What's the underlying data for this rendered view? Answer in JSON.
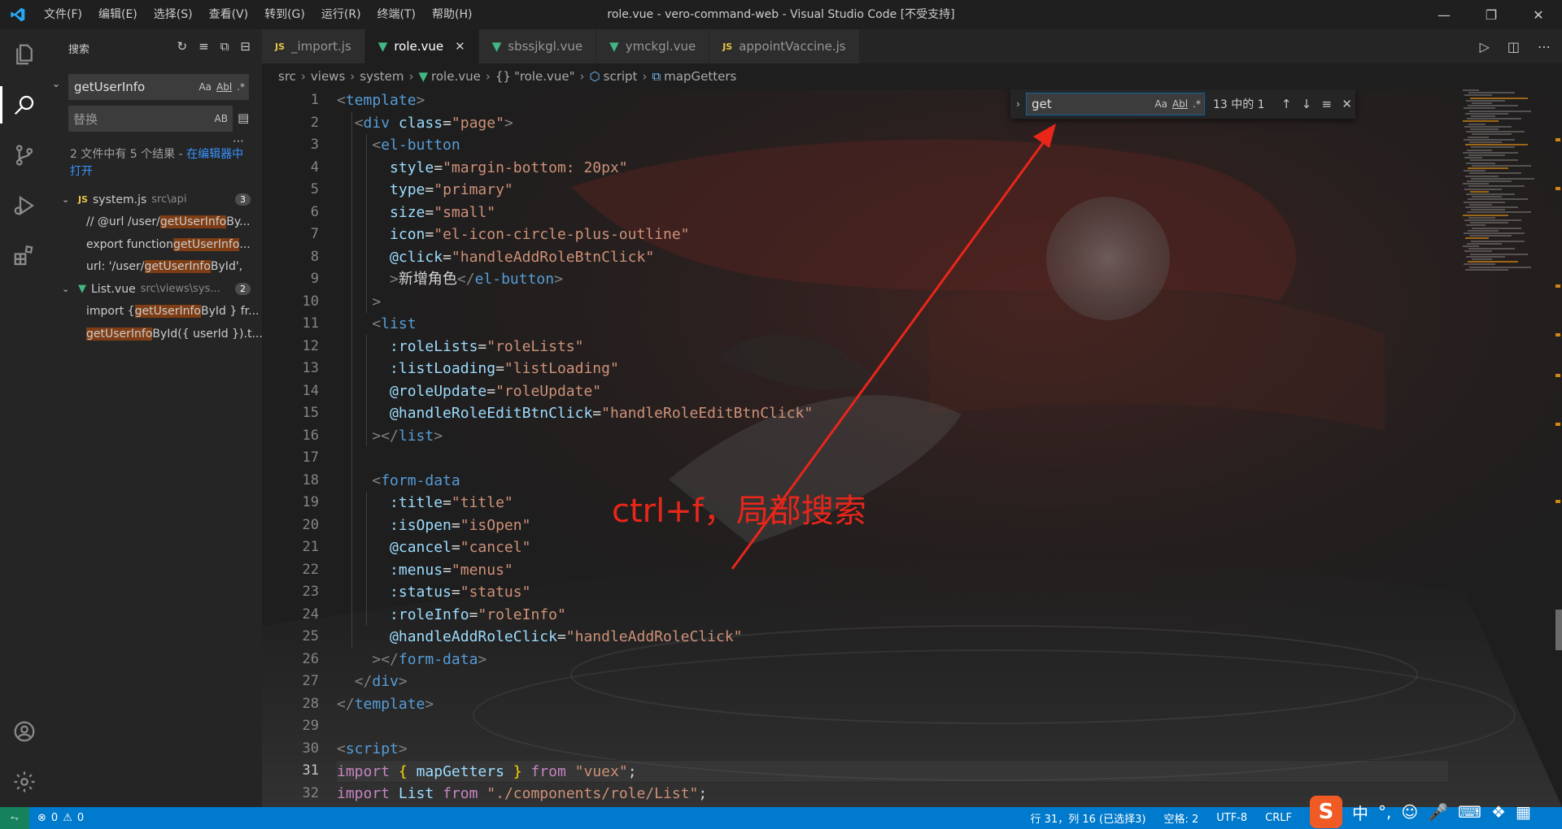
{
  "titlebar": {
    "menus": [
      "文件(F)",
      "编辑(E)",
      "选择(S)",
      "查看(V)",
      "转到(G)",
      "运行(R)",
      "终端(T)",
      "帮助(H)"
    ],
    "title": "role.vue - vero-command-web - Visual Studio Code [不受支持]"
  },
  "sidebar": {
    "header": "搜索",
    "search_value": "getUserInfo",
    "opt_case": "Aa",
    "opt_word": "Abl",
    "opt_regex": ".*",
    "replace_placeholder": "替换",
    "replace_opt": "AB",
    "results_msg": "2 文件中有 5 个结果 - ",
    "results_link": "在编辑器中打开",
    "files": [
      {
        "name": "system.js",
        "path": "src\\api",
        "count": "3",
        "type": "js",
        "matches": [
          {
            "pre": "// @url /user/",
            "hit": "getUserInfo",
            "post": "By..."
          },
          {
            "pre": "export function ",
            "hit": "getUserInfo",
            "post": "..."
          },
          {
            "pre": "url: '/user/",
            "hit": "getUserInfo",
            "post": "ById',"
          }
        ]
      },
      {
        "name": "List.vue",
        "path": "src\\views\\sys...",
        "count": "2",
        "type": "vue",
        "matches": [
          {
            "pre": "import { ",
            "hit": "getUserInfo",
            "post": "ById } fr..."
          },
          {
            "pre": "",
            "hit": "getUserInfo",
            "post": "ById({ userId }).t..."
          }
        ]
      }
    ]
  },
  "tabs": [
    {
      "label": "_import.js",
      "type": "js",
      "active": false
    },
    {
      "label": "role.vue",
      "type": "vue",
      "active": true
    },
    {
      "label": "sbssjkgl.vue",
      "type": "vue",
      "active": false
    },
    {
      "label": "ymckgl.vue",
      "type": "vue",
      "active": false
    },
    {
      "label": "appointVaccine.js",
      "type": "js",
      "active": false
    }
  ],
  "breadcrumb": {
    "items": [
      "src",
      "views",
      "system",
      "role.vue",
      "\"role.vue\"",
      "script",
      "mapGetters"
    ]
  },
  "find": {
    "value": "get",
    "opt_case": "Aa",
    "opt_word": "Abl",
    "opt_regex": ".*",
    "count": "13 中的 1"
  },
  "code": {
    "lines": [
      [
        [
          "b",
          "<"
        ],
        [
          "t",
          "template"
        ],
        [
          "b",
          ">"
        ]
      ],
      [
        [
          "w",
          "  "
        ],
        [
          "b",
          "<"
        ],
        [
          "t",
          "div"
        ],
        [
          "w",
          " "
        ],
        [
          "a",
          "class"
        ],
        [
          "w",
          "="
        ],
        [
          "s",
          "\"page\""
        ],
        [
          "b",
          ">"
        ]
      ],
      [
        [
          "w",
          "    "
        ],
        [
          "b",
          "<"
        ],
        [
          "t",
          "el-button"
        ]
      ],
      [
        [
          "w",
          "      "
        ],
        [
          "a",
          "style"
        ],
        [
          "w",
          "="
        ],
        [
          "s",
          "\"margin-bottom: 20px\""
        ]
      ],
      [
        [
          "w",
          "      "
        ],
        [
          "a",
          "type"
        ],
        [
          "w",
          "="
        ],
        [
          "s",
          "\"primary\""
        ]
      ],
      [
        [
          "w",
          "      "
        ],
        [
          "a",
          "size"
        ],
        [
          "w",
          "="
        ],
        [
          "s",
          "\"small\""
        ]
      ],
      [
        [
          "w",
          "      "
        ],
        [
          "a",
          "icon"
        ],
        [
          "w",
          "="
        ],
        [
          "s",
          "\"el-icon-circle-plus-outline\""
        ]
      ],
      [
        [
          "w",
          "      "
        ],
        [
          "a",
          "@click"
        ],
        [
          "w",
          "="
        ],
        [
          "s",
          "\"handleAddRoleBtnClick\""
        ]
      ],
      [
        [
          "w",
          "      "
        ],
        [
          "b",
          ">"
        ],
        [
          "w",
          "新增角色"
        ],
        [
          "b",
          "</"
        ],
        [
          "t",
          "el-button"
        ],
        [
          "b",
          ">"
        ]
      ],
      [
        [
          "w",
          "    "
        ],
        [
          "b",
          ">"
        ]
      ],
      [
        [
          "w",
          "    "
        ],
        [
          "b",
          "<"
        ],
        [
          "t",
          "list"
        ]
      ],
      [
        [
          "w",
          "      "
        ],
        [
          "a",
          ":roleLists"
        ],
        [
          "w",
          "="
        ],
        [
          "s",
          "\"roleLists\""
        ]
      ],
      [
        [
          "w",
          "      "
        ],
        [
          "a",
          ":listLoading"
        ],
        [
          "w",
          "="
        ],
        [
          "s",
          "\"listLoading\""
        ]
      ],
      [
        [
          "w",
          "      "
        ],
        [
          "a",
          "@roleUpdate"
        ],
        [
          "w",
          "="
        ],
        [
          "s",
          "\"roleUpdate\""
        ]
      ],
      [
        [
          "w",
          "      "
        ],
        [
          "a",
          "@handleRoleEditBtnClick"
        ],
        [
          "w",
          "="
        ],
        [
          "s",
          "\"handleRoleEditBtnClick\""
        ]
      ],
      [
        [
          "w",
          "    "
        ],
        [
          "b",
          "></"
        ],
        [
          "t",
          "list"
        ],
        [
          "b",
          ">"
        ]
      ],
      [
        [
          "w",
          ""
        ]
      ],
      [
        [
          "w",
          "    "
        ],
        [
          "b",
          "<"
        ],
        [
          "t",
          "form-data"
        ]
      ],
      [
        [
          "w",
          "      "
        ],
        [
          "a",
          ":title"
        ],
        [
          "w",
          "="
        ],
        [
          "s",
          "\"title\""
        ]
      ],
      [
        [
          "w",
          "      "
        ],
        [
          "a",
          ":isOpen"
        ],
        [
          "w",
          "="
        ],
        [
          "s",
          "\"isOpen\""
        ]
      ],
      [
        [
          "w",
          "      "
        ],
        [
          "a",
          "@cancel"
        ],
        [
          "w",
          "="
        ],
        [
          "s",
          "\"cancel\""
        ]
      ],
      [
        [
          "w",
          "      "
        ],
        [
          "a",
          ":menus"
        ],
        [
          "w",
          "="
        ],
        [
          "s",
          "\"menus\""
        ]
      ],
      [
        [
          "w",
          "      "
        ],
        [
          "a",
          ":status"
        ],
        [
          "w",
          "="
        ],
        [
          "s",
          "\"status\""
        ]
      ],
      [
        [
          "w",
          "      "
        ],
        [
          "a",
          ":roleInfo"
        ],
        [
          "w",
          "="
        ],
        [
          "s",
          "\"roleInfo\""
        ]
      ],
      [
        [
          "w",
          "      "
        ],
        [
          "a",
          "@handleAddRoleClick"
        ],
        [
          "w",
          "="
        ],
        [
          "s",
          "\"handleAddRoleClick\""
        ]
      ],
      [
        [
          "w",
          "    "
        ],
        [
          "b",
          "></"
        ],
        [
          "t",
          "form-data"
        ],
        [
          "b",
          ">"
        ]
      ],
      [
        [
          "w",
          "  "
        ],
        [
          "b",
          "</"
        ],
        [
          "t",
          "div"
        ],
        [
          "b",
          ">"
        ]
      ],
      [
        [
          "b",
          "</"
        ],
        [
          "t",
          "template"
        ],
        [
          "b",
          ">"
        ]
      ],
      [
        [
          "w",
          ""
        ]
      ],
      [
        [
          "b",
          "<"
        ],
        [
          "t",
          "script"
        ],
        [
          "b",
          ">"
        ]
      ],
      [
        [
          "p",
          "import"
        ],
        [
          "w",
          " "
        ],
        [
          "y",
          "{"
        ],
        [
          "w",
          " "
        ],
        [
          "a",
          "mapGetters"
        ],
        [
          "w",
          " "
        ],
        [
          "y",
          "}"
        ],
        [
          "w",
          " "
        ],
        [
          "p",
          "from"
        ],
        [
          "w",
          " "
        ],
        [
          "s",
          "\"vuex\""
        ],
        [
          "w",
          ";"
        ]
      ],
      [
        [
          "p",
          "import"
        ],
        [
          "w",
          " "
        ],
        [
          "a",
          "List"
        ],
        [
          "w",
          " "
        ],
        [
          "p",
          "from"
        ],
        [
          "w",
          " "
        ],
        [
          "s",
          "\"./components/role/List\""
        ],
        [
          "w",
          ";"
        ]
      ]
    ]
  },
  "annotation": {
    "text": "ctrl+f，局部搜索"
  },
  "status": {
    "errors": "0",
    "warnings": "0",
    "position": "行 31，列 16 (已选择3)",
    "spaces": "空格: 2",
    "encoding": "UTF-8",
    "eol": "CRLF"
  },
  "ime": {
    "logo": "S",
    "lang": "中"
  }
}
